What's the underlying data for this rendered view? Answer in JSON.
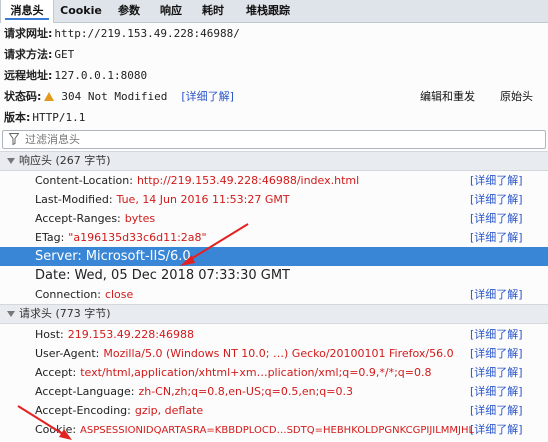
{
  "tabs": [
    {
      "label": "消息头"
    },
    {
      "label": "Cookie"
    },
    {
      "label": "参数"
    },
    {
      "label": "响应"
    },
    {
      "label": "耗时"
    },
    {
      "label": "堆栈跟踪"
    }
  ],
  "summary": {
    "request_url_label": "请求网址:",
    "request_url": "http://219.153.49.228:46988/",
    "method_label": "请求方法:",
    "method": "GET",
    "remote_label": "远程地址:",
    "remote": "127.0.0.1:8080",
    "status_label": "状态码:",
    "status": "304 Not Modified",
    "status_link": "[详细了解]",
    "edit_resend": "编辑和重发",
    "raw_headers": "原始头",
    "version_label": "版本:",
    "version": "HTTP/1.1"
  },
  "filter": {
    "placeholder": "过滤消息头"
  },
  "response_headers": {
    "title": "响应头 (267 字节)",
    "rows": [
      {
        "name": "Content-Location:",
        "value": "http://219.153.49.228:46988/index.html",
        "link": "[详细了解]"
      },
      {
        "name": "Last-Modified:",
        "value": "Tue, 14 Jun 2016 11:53:27 GMT",
        "link": "[详细了解]"
      },
      {
        "name": "Accept-Ranges:",
        "value": "bytes",
        "link": "[详细了解]"
      },
      {
        "name": "ETag:",
        "value": "\"a196135d33c6d11:2a8\"",
        "link": "[详细了解]"
      },
      {
        "name": "Server:",
        "value": "Microsoft-IIS/6.0",
        "link": ""
      },
      {
        "name": "Date:",
        "value": "Wed, 05 Dec 2018 07:33:30 GMT",
        "link": ""
      },
      {
        "name": "Connection:",
        "value": "close",
        "link": "[详细了解]"
      }
    ]
  },
  "request_headers": {
    "title": "请求头 (773 字节)",
    "rows": [
      {
        "name": "Host:",
        "value": "219.153.49.228:46988",
        "link": "[详细了解]"
      },
      {
        "name": "User-Agent:",
        "value": "Mozilla/5.0 (Windows NT 10.0; …) Gecko/20100101 Firefox/56.0",
        "link": "[详细了解]"
      },
      {
        "name": "Accept:",
        "value": "text/html,application/xhtml+xm…plication/xml;q=0.9,*/*;q=0.8",
        "link": "[详细了解]"
      },
      {
        "name": "Accept-Language:",
        "value": "zh-CN,zh;q=0.8,en-US;q=0.5,en;q=0.3",
        "link": "[详细了解]"
      },
      {
        "name": "Accept-Encoding:",
        "value": "gzip, deflate",
        "link": "[详细了解]"
      },
      {
        "name": "Cookie:",
        "value": "ASPSESSIONIDQARTASRA=KBBDPLOCD…SDTQ=HEBHKOLDPGNKCGPIJILMMJHL",
        "link": "[详细了解]"
      }
    ]
  },
  "colors": {
    "accent": "#3a86d6",
    "value_red": "#d21a1a",
    "link_blue": "#2a55c9",
    "warning": "#e39a1c"
  }
}
